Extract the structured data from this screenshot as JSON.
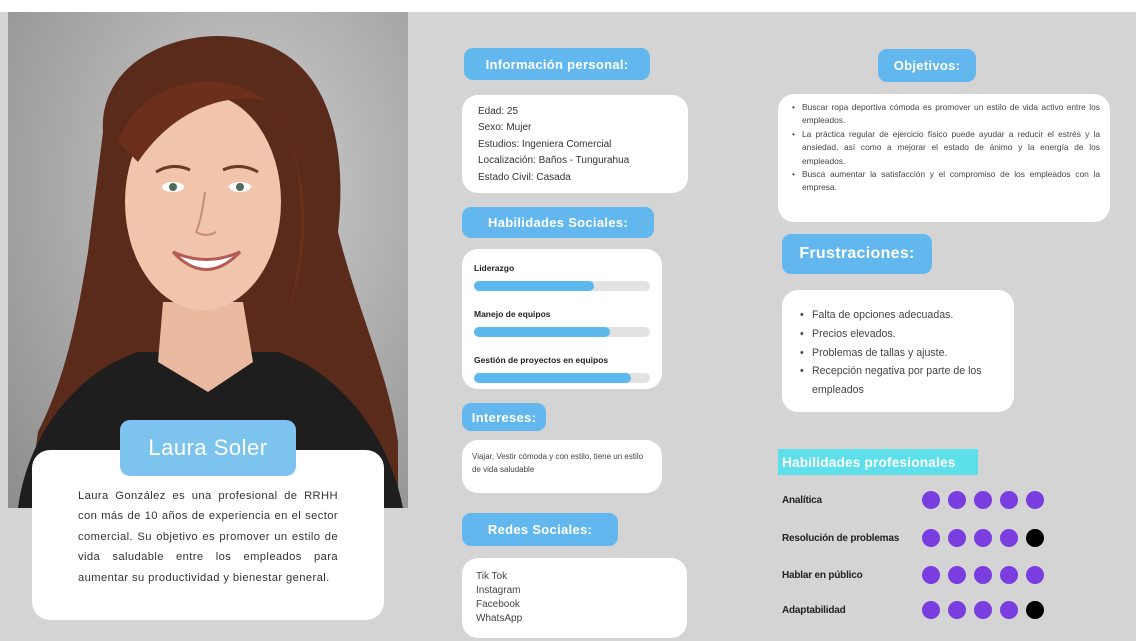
{
  "persona": {
    "name": "Laura Soler",
    "bio": "Laura González es una profesional de RRHH con más de 10 años de experiencia en el sector comercial. Su objetivo es promover un estilo de vida saludable entre los empleados para aumentar su productividad y bienestar general."
  },
  "personal_info": {
    "title": "Información personal:",
    "lines": [
      "Edad: 25",
      "Sexo: Mujer",
      "Estudios: Ingeniera Comercial",
      "Localización: Baños - Tungurahua",
      "Estado Civil: Casada"
    ]
  },
  "social_skills": {
    "title": "Habilidades Sociales:",
    "items": [
      {
        "label": "Liderazgo",
        "level": 0.68
      },
      {
        "label": "Manejo de equipos",
        "level": 0.77
      },
      {
        "label": "Gestión de proyectos en equipos",
        "level": 0.89
      }
    ]
  },
  "interests": {
    "title": "Intereses:",
    "text": "Viajar, Vestir cómoda y con estilo, tiene un estilo de vida saludable"
  },
  "social_networks": {
    "title": "Redes Sociales:",
    "items": [
      "Tik Tok",
      "Instagram",
      "Facebook",
      "WhatsApp"
    ]
  },
  "objectives": {
    "title": "Objetivos:",
    "items": [
      "Buscar ropa deportiva cómoda es promover un estilo de vida activo entre los empleados.",
      "La práctica regular de ejercicio físico puede ayudar a reducir el estrés y la ansiedad, así como a mejorar el estado de ánimo y la energía de los empleados.",
      "Busca aumentar la satisfacción y el compromiso de los empleados con la empresa."
    ]
  },
  "frustrations": {
    "title": "Frustraciones:",
    "items": [
      "Falta de opciones adecuadas.",
      "Precios elevados.",
      "Problemas de tallas y ajuste.",
      "Recepción negativa por parte de los empleados"
    ]
  },
  "professional_skills": {
    "title": "Habilidades profesionales",
    "items": [
      {
        "label": "Analítica",
        "rating": 5,
        "max": 5
      },
      {
        "label": "Resolución de problemas",
        "rating": 4,
        "max": 5
      },
      {
        "label": "Hablar en público",
        "rating": 5,
        "max": 5
      },
      {
        "label": "Adaptabilidad",
        "rating": 4,
        "max": 5
      }
    ]
  },
  "colors": {
    "pill": "#62b8ee",
    "rating_on": "#7a3ddf",
    "rating_off": "#000000",
    "accent_title": "#5ee0ea"
  }
}
